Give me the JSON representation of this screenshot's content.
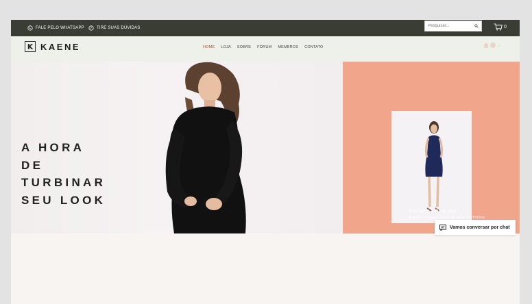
{
  "topbar": {
    "whatsapp_label": "FALE PELO WHATSAPP",
    "help_label": "TIRE SUAS DÚVIDAS",
    "search_placeholder": "Pesquisar...",
    "cart_count": "0"
  },
  "header": {
    "logo_text": "KAENE",
    "logo_mark": "K",
    "nav": [
      {
        "label": "HOME",
        "active": true
      },
      {
        "label": "LOJA"
      },
      {
        "label": "SOBRE"
      },
      {
        "label": "FÓRUM"
      },
      {
        "label": "MEMBROS"
      },
      {
        "label": "CONTATO"
      }
    ]
  },
  "hero": {
    "headline_lines": [
      "A HORA",
      "DE",
      "TURBINAR",
      "SEU LOOK"
    ],
    "accent_color": "#f1a68c"
  },
  "overlay": {
    "watermark_title": "Ativar o Windows",
    "watermark_sub": "Acesse Configurações para ativar o Windows."
  },
  "chat": {
    "label": "Vamos conversar por chat"
  },
  "colors": {
    "topbar_bg": "#3a3d33",
    "header_bg": "#eef1ea",
    "active_nav": "#b2492e",
    "page_bg": "#f8f4f1"
  }
}
